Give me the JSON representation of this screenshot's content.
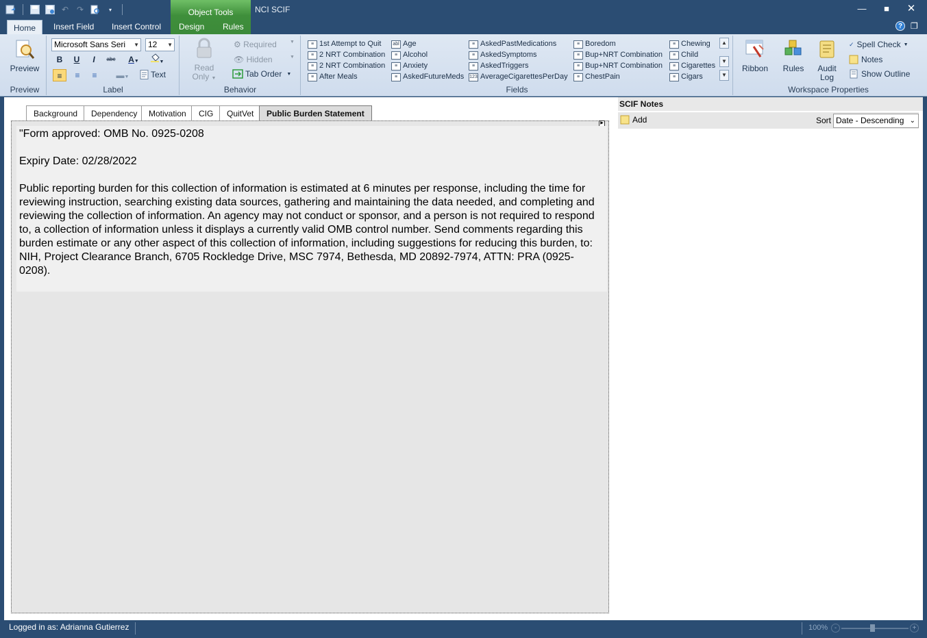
{
  "app": {
    "title": "NCI SCIF",
    "context_group": "Object Tools"
  },
  "ribbon_tabs": [
    {
      "label": "Home"
    },
    {
      "label": "Insert Field"
    },
    {
      "label": "Insert Control"
    },
    {
      "label": "Design"
    },
    {
      "label": "Rules"
    }
  ],
  "preview_group": {
    "button": "Preview",
    "label": "Preview"
  },
  "label_group": {
    "font_name": "Microsoft Sans Seri",
    "font_size": "12",
    "text_button": "Text",
    "label": "Label"
  },
  "behavior_group": {
    "read_only_1": "Read",
    "read_only_2": "Only",
    "required": "Required",
    "hidden": "Hidden",
    "tab_order": "Tab Order",
    "label": "Behavior"
  },
  "fields_group": {
    "label": "Fields",
    "col1": [
      "1st Attempt to Quit",
      "2 NRT Combination",
      "2 NRT Combination",
      "After Meals"
    ],
    "col2": [
      "Age",
      "Alcohol",
      "Anxiety",
      "AskedFutureMeds"
    ],
    "col3": [
      "AskedPastMedications",
      "AskedSymptoms",
      "AskedTriggers",
      "AverageCigarettesPerDay"
    ],
    "col4": [
      "Boredom",
      "Bup+NRT Combination",
      "Bup+NRT Combination",
      "ChestPain"
    ],
    "col5": [
      "Chewing",
      "Child",
      "Cigarettes",
      "Cigars"
    ]
  },
  "workspace_group": {
    "ribbon": "Ribbon",
    "rules": "Rules",
    "audit_1": "Audit",
    "audit_2": "Log",
    "spell_check": "Spell Check",
    "notes": "Notes",
    "show_outline": "Show Outline",
    "label": "Workspace Properties"
  },
  "form_tabs": [
    {
      "label": "Background"
    },
    {
      "label": "Dependency"
    },
    {
      "label": "Motivation"
    },
    {
      "label": "CIG"
    },
    {
      "label": "QuitVet"
    },
    {
      "label": "Public Burden Statement"
    }
  ],
  "form_text": {
    "line1": "\"Form approved: OMB No. 0925-0208",
    "line2": "Expiry Date:  02/28/2022",
    "paragraph": "Public reporting burden for this collection of information is estimated at 6 minutes per response, including the time for reviewing instruction, searching existing data sources, gathering and maintaining the data needed, and completing and reviewing the collection of information. An agency may not conduct or sponsor, and a person is not required to respond to, a collection of information unless it displays a currently valid OMB control number. Send comments regarding this burden estimate or any other aspect of this collection of information, including suggestions for reducing this burden, to: NIH, Project Clearance Branch, 6705 Rockledge Drive, MSC 7974, Bethesda, MD 20892-7974, ATTN: PRA (0925-0208)."
  },
  "notes_panel": {
    "title": "SCIF Notes",
    "add": "Add",
    "sort_label": "Sort",
    "sort_value": "Date - Descending"
  },
  "status_bar": {
    "logged_in": "Logged in as: Adrianna Gutierrez",
    "zoom": "100%"
  }
}
